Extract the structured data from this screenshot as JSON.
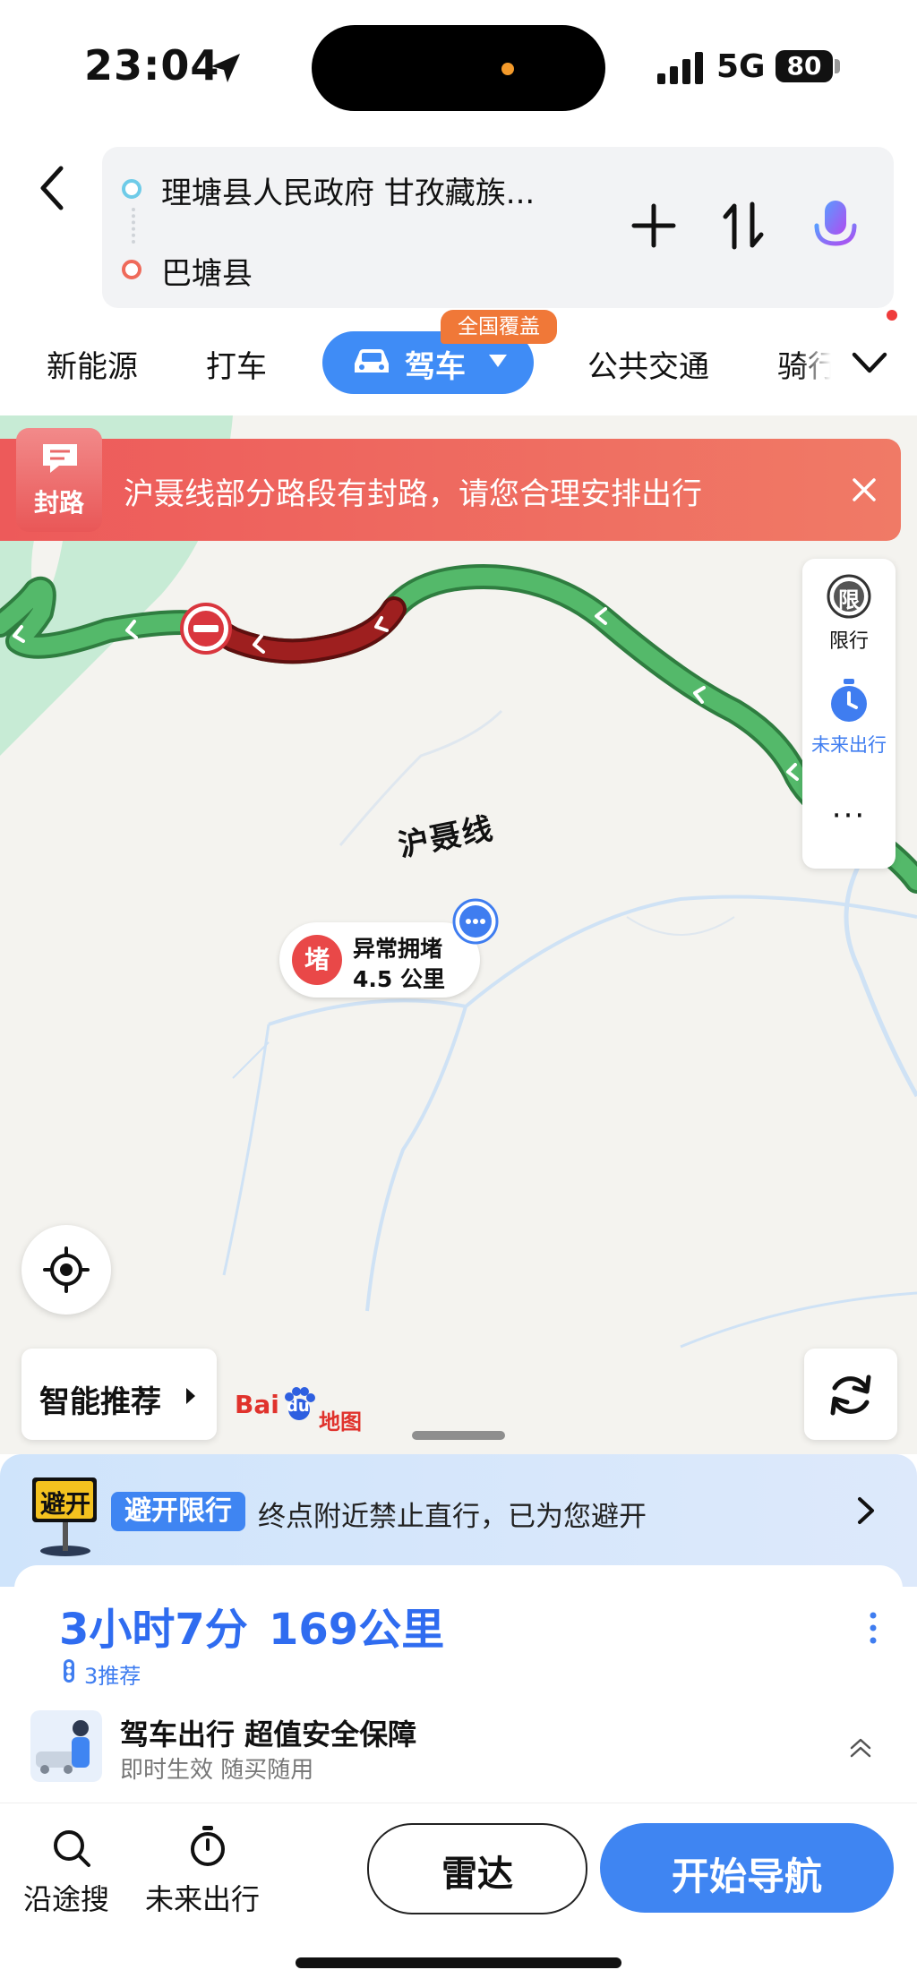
{
  "status_bar": {
    "time": "23:04",
    "network": "5G",
    "battery": "80"
  },
  "route_header": {
    "start": "理塘县人民政府 甘孜藏族...",
    "end": "巴塘县"
  },
  "modes": {
    "tabs": [
      {
        "label": "新能源"
      },
      {
        "label": "打车"
      },
      {
        "label": "驾车",
        "active": true
      },
      {
        "label": "公共交通"
      },
      {
        "label": "骑行"
      }
    ],
    "coverage_badge": "全国覆盖"
  },
  "alert": {
    "icon_label": "封路",
    "text": "沪聂线部分路段有封路，请您合理安排出行"
  },
  "side_panel": {
    "restrict_label": "限行",
    "restrict_glyph": "限",
    "future_label": "未来出行",
    "more": "···"
  },
  "map": {
    "road_name": "沪聂线",
    "jam_badge": "堵",
    "jam_title": "异常拥堵",
    "jam_distance": "4.5 公里",
    "smart_label": "智能推荐",
    "logo_text": "Bai",
    "logo_paw": "du",
    "logo_map": "地图",
    "colors": {
      "route_green": "#54b96a",
      "route_jam": "#9e1f1f",
      "water": "#c7ebd5",
      "river": "#cfe2f5"
    }
  },
  "avoid": {
    "sign": "避开",
    "tag": "避开限行",
    "text": "终点附近禁止直行，已为您避开"
  },
  "route": {
    "time": "3小时7分",
    "distance": "169公里",
    "recommend": "3推荐"
  },
  "insurance": {
    "title": "驾车出行 超值安全保障",
    "subtitle": "即时生效 随买随用"
  },
  "bottom": {
    "along_label": "沿途搜",
    "future_label": "未来出行",
    "radar_label": "雷达",
    "nav_label": "开始导航"
  }
}
